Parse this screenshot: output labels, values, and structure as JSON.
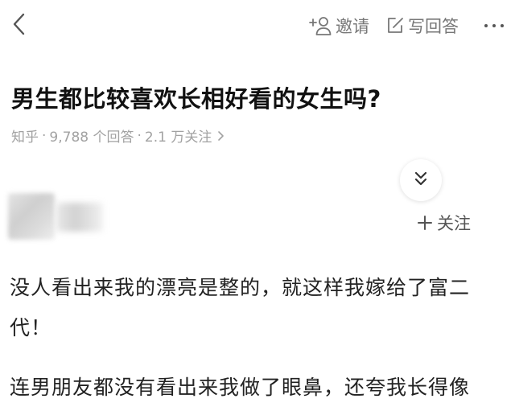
{
  "topbar": {
    "invite_label": "邀请",
    "write_answer_label": "写回答"
  },
  "question": {
    "title": "男生都比较喜欢长相好看的女生吗?",
    "source": "知乎",
    "answers_count": "9,788 个回答",
    "followers_count": "2.1 万关注"
  },
  "answer": {
    "follow_label": "关注",
    "paragraphs": [
      "没人看出来我的漂亮是整的，就这样我嫁给了富二代！",
      "连男朋友都没有看出来我做了眼鼻，还夸我长得像"
    ]
  },
  "colors": {
    "text": "#1a1a1a",
    "muted": "#a2a2a2",
    "icon": "#777777"
  }
}
